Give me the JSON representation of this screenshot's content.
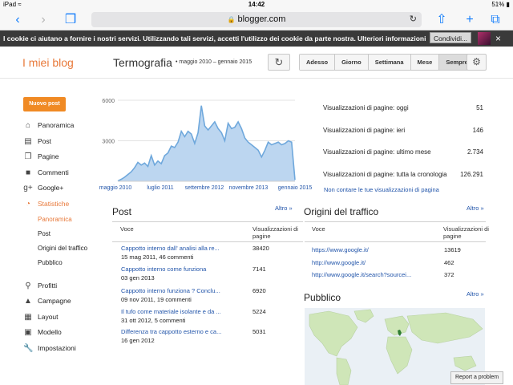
{
  "status_bar": {
    "device": "iPad",
    "wifi_icon": "wifi-icon",
    "time": "14:42",
    "battery": "51%"
  },
  "browser": {
    "url": "blogger.com"
  },
  "cookie_banner": {
    "text": "I cookie ci aiutano a fornire i nostri servizi. Utilizzando tali servizi, accetti l'utilizzo dei cookie da parte nostra.",
    "more_link": "Ulteriori informazioni",
    "share_label": "Condividi..."
  },
  "header": {
    "blog_name": "I miei blog",
    "page_title": "Termografia",
    "date_range": "maggio 2010 – gennaio 2015",
    "range_buttons": [
      "Adesso",
      "Giorno",
      "Settimana",
      "Mese",
      "Sempre"
    ],
    "active_range": "Sempre"
  },
  "sidebar": {
    "new_post_label": "Nuovo post",
    "items": [
      {
        "label": "Panoramica",
        "icon": "home-icon"
      },
      {
        "label": "Post",
        "icon": "post-icon"
      },
      {
        "label": "Pagine",
        "icon": "pages-icon"
      },
      {
        "label": "Commenti",
        "icon": "comment-icon"
      },
      {
        "label": "Google+",
        "icon": "google-plus-icon"
      },
      {
        "label": "Statistiche",
        "icon": "stats-icon"
      }
    ],
    "stats_subitems": [
      "Panoramica",
      "Post",
      "Origini del traffico",
      "Pubblico"
    ],
    "items2": [
      {
        "label": "Profitti",
        "icon": "trophy-icon"
      },
      {
        "label": "Campagne",
        "icon": "campaign-icon"
      },
      {
        "label": "Layout",
        "icon": "layout-icon"
      },
      {
        "label": "Modello",
        "icon": "template-icon"
      },
      {
        "label": "Impostazioni",
        "icon": "wrench-icon"
      }
    ]
  },
  "chart_data": {
    "type": "area",
    "x_ticks": [
      "maggio 2010",
      "luglio 2011",
      "settembre 2012",
      "novembre 2013",
      "gennaio 2015"
    ],
    "y_ticks": [
      6000,
      3000
    ],
    "ylim": [
      0,
      6000
    ],
    "values": [
      20,
      150,
      300,
      500,
      700,
      1000,
      1400,
      1200,
      1350,
      1100,
      1900,
      1200,
      1500,
      1300,
      1900,
      2100,
      2600,
      2500,
      2900,
      3700,
      3300,
      3700,
      3500,
      2800,
      3600,
      5600,
      4100,
      3800,
      4100,
      4400,
      3900,
      3600,
      3000,
      4300,
      3900,
      4000,
      4400,
      3900,
      3200,
      2900,
      2700,
      2500,
      2300,
      1800,
      2300,
      2900,
      2700,
      2800,
      2900,
      2700,
      2800,
      3000,
      2900,
      100
    ],
    "color": "#6fa8dc",
    "fill": "#bcd6f0"
  },
  "stats_summary": [
    {
      "label": "Visualizzazioni di pagine: oggi",
      "value": "51"
    },
    {
      "label": "Visualizzazioni di pagine: ieri",
      "value": "146"
    },
    {
      "label": "Visualizzazioni di pagine: ultimo mese",
      "value": "2.734"
    },
    {
      "label": "Visualizzazioni di pagine: tutta la cronologia",
      "value": "126.291"
    }
  ],
  "no_track_link": "Non contare le tue visualizzazioni di pagina",
  "posts": {
    "title": "Post",
    "more": "Altro »",
    "col_item": "Voce",
    "col_views": "Visualizzazioni di pagine",
    "rows": [
      {
        "title": "Cappotto interno dall' analisi alla re...",
        "meta": "15 mag 2011, 46 commenti",
        "views": "38420"
      },
      {
        "title": "Cappotto interno come funziona",
        "meta": "03 gen 2013",
        "views": "7141"
      },
      {
        "title": "Cappotto interno funziona ? Conclu...",
        "meta": "09 nov 2011, 19 commenti",
        "views": "6920"
      },
      {
        "title": "Il tufo come materiale isolante e da ...",
        "meta": "31 ott 2012, 5 commenti",
        "views": "5224"
      },
      {
        "title": "Differenza tra cappotto esterno e ca...",
        "meta": "16 gen 2012",
        "views": "5031"
      }
    ]
  },
  "traffic": {
    "title": "Origini del traffico",
    "more": "Altro »",
    "col_item": "Voce",
    "col_views": "Visualizzazioni di pagine",
    "rows": [
      {
        "source": "https://www.google.it/",
        "views": "13619"
      },
      {
        "source": "http://www.google.it/",
        "views": "462"
      },
      {
        "source": "http://www.google.it/search?sourcei...",
        "views": "372"
      }
    ]
  },
  "audience": {
    "title": "Pubblico",
    "more": "Altro »"
  },
  "report_problem": "Report a problem"
}
